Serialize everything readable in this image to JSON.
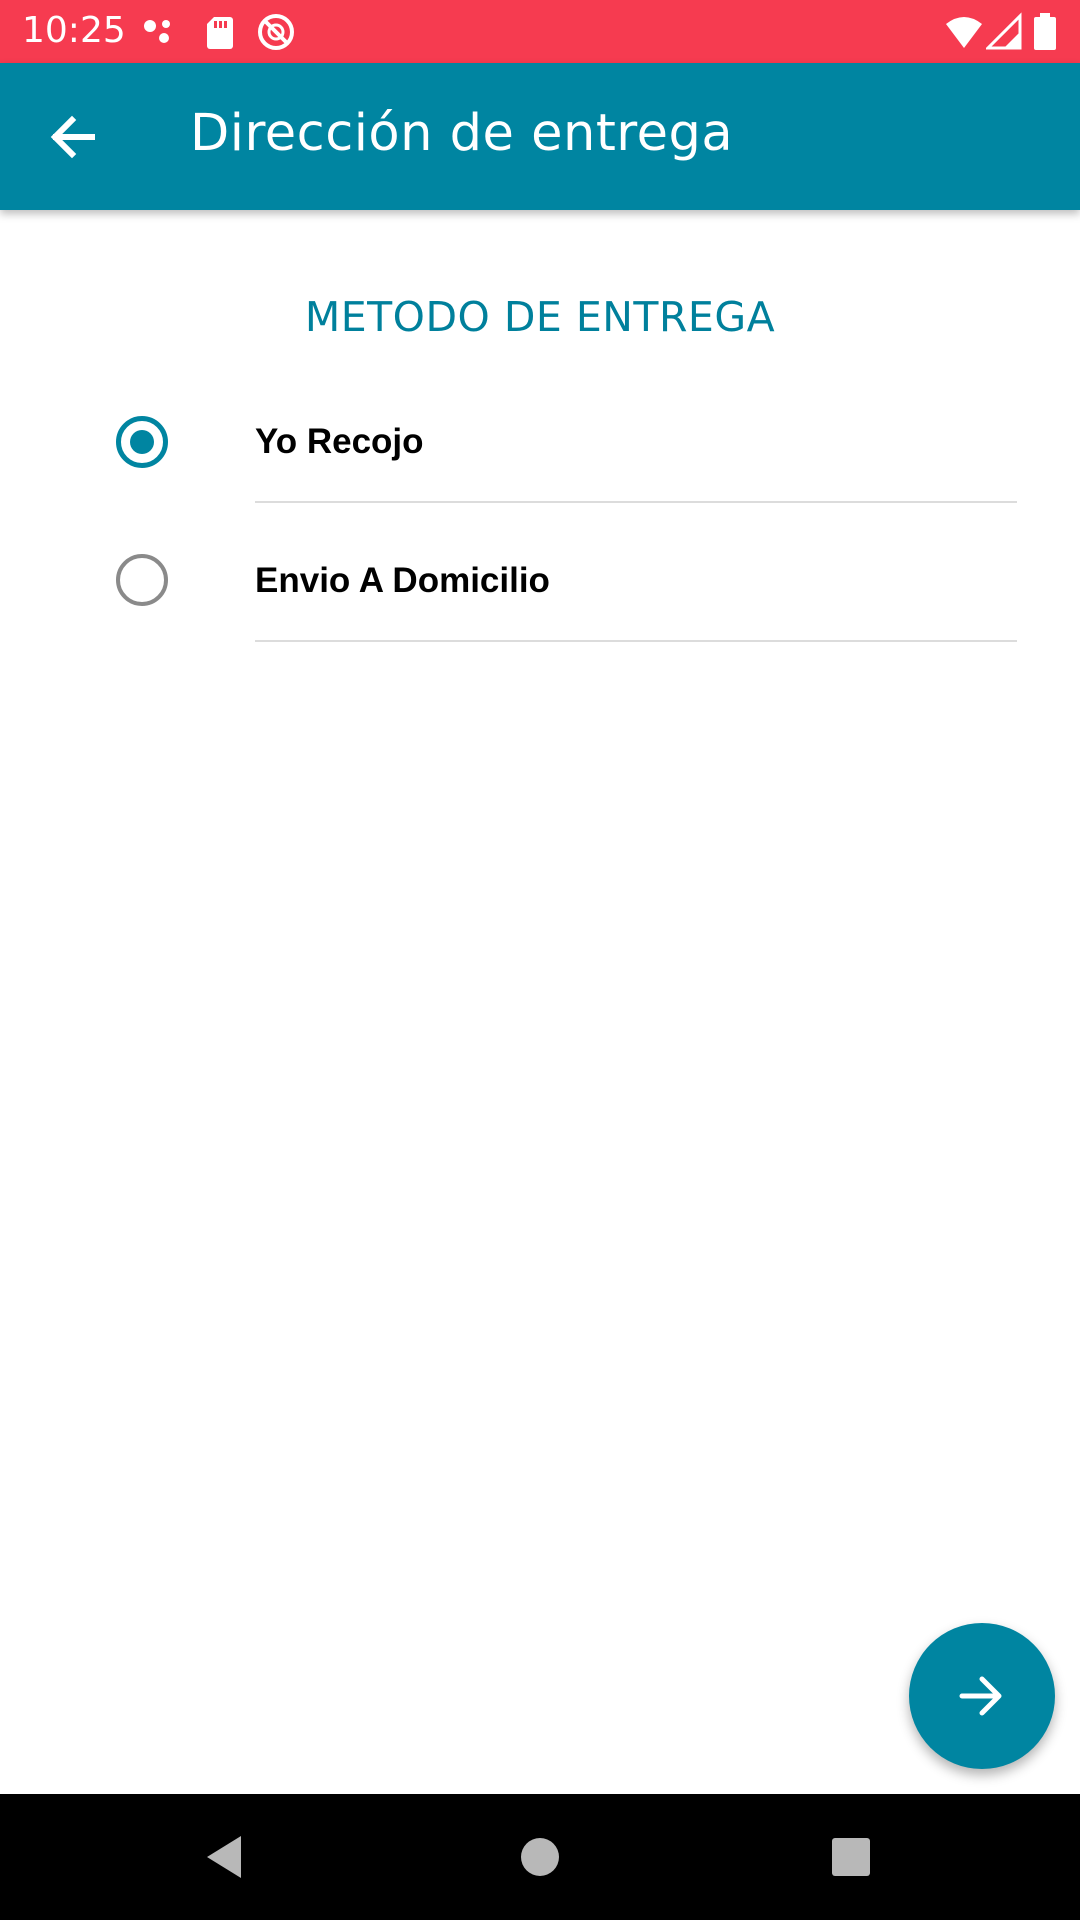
{
  "status_bar": {
    "time": "10:25",
    "background_color": "#f63b50",
    "left_icons": [
      "assistant-dots-icon",
      "sd-card-icon",
      "no-disturb-icon"
    ],
    "right_icons": [
      "wifi-icon",
      "cell-signal-icon",
      "battery-icon"
    ]
  },
  "app_bar": {
    "title": "Dirección de entrega",
    "back_icon": "arrow-back-icon",
    "background_color": "#0085a1"
  },
  "main": {
    "section_heading": "METODO DE ENTREGA",
    "options": [
      {
        "label": "Yo Recojo",
        "selected": true
      },
      {
        "label": "Envio A Domicilio",
        "selected": false
      }
    ]
  },
  "fab": {
    "icon": "arrow-forward-icon",
    "color": "#0085a1"
  },
  "nav_bar": {
    "icons": [
      "nav-back-icon",
      "nav-home-icon",
      "nav-recents-icon"
    ]
  }
}
